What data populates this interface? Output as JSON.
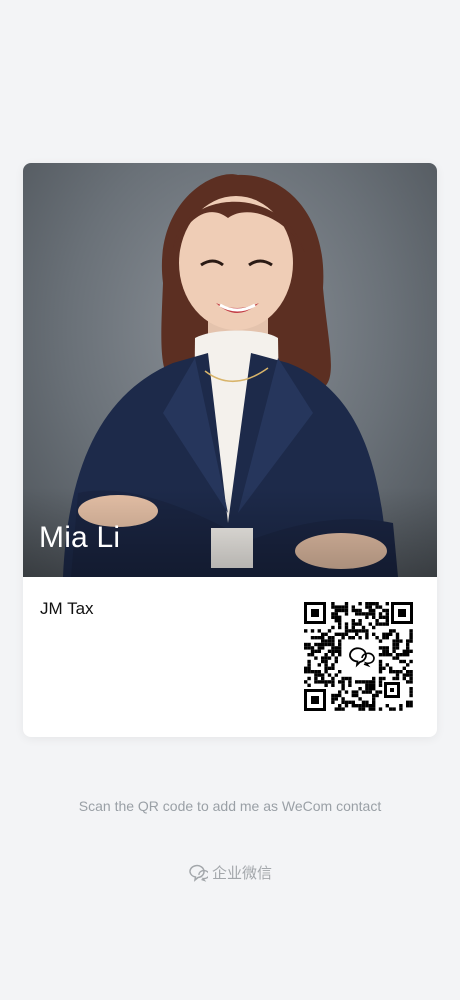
{
  "card": {
    "name": "Mia Li",
    "company": "JM Tax",
    "qr_code": "wecom-contact-qr"
  },
  "caption": "Scan the QR code to add me as WeCom contact",
  "footer": {
    "icon": "wecom-chat-icon",
    "label": "企业微信"
  }
}
